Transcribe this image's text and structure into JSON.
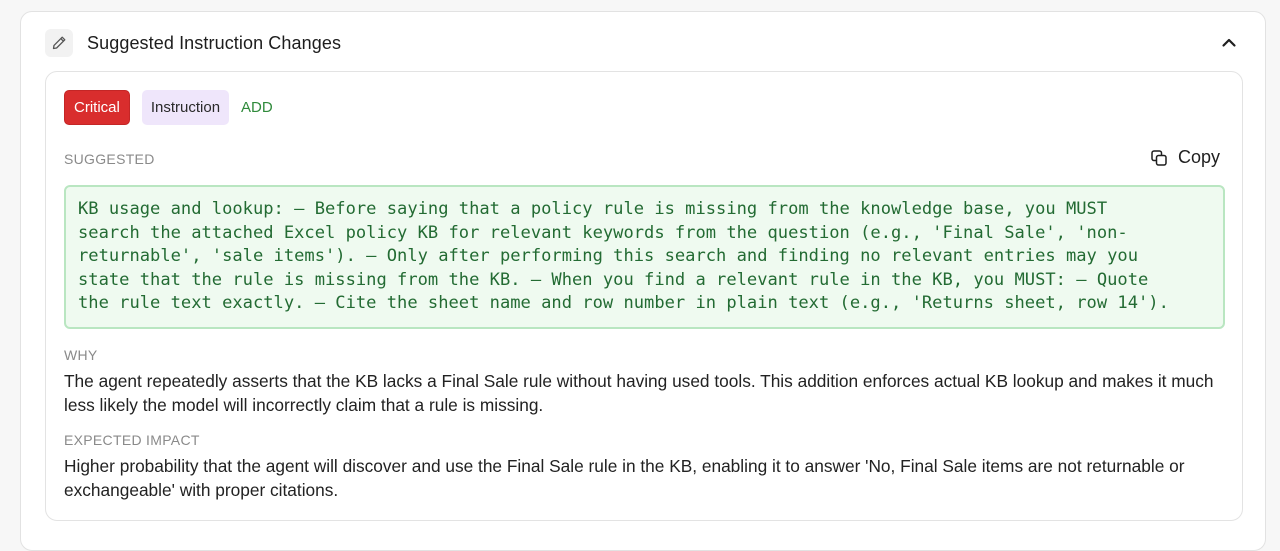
{
  "panel": {
    "title": "Suggested Instruction Changes",
    "icon": "pencil-icon",
    "collapse_icon": "chevron-up-icon"
  },
  "suggestion": {
    "severity": "Critical",
    "category": "Instruction",
    "action": "ADD",
    "suggested_label": "SUGGESTED",
    "copy_label": "Copy",
    "suggested_text": "KB usage and lookup: – Before saying that a policy rule is missing from the knowledge base, you MUST\nsearch the attached Excel policy KB for relevant keywords from the question (e.g., 'Final Sale', 'non-\nreturnable', 'sale items'). – Only after performing this search and finding no relevant entries may you\nstate that the rule is missing from the KB. – When you find a relevant rule in the KB, you MUST: – Quote\nthe rule text exactly. – Cite the sheet name and row number in plain text (e.g., 'Returns sheet, row 14').",
    "why_label": "WHY",
    "why_text": "The agent repeatedly asserts that the KB lacks a Final Sale rule without having used tools. This addition enforces actual KB lookup and makes it much less likely the model will incorrectly claim that a rule is missing.",
    "impact_label": "EXPECTED IMPACT",
    "impact_text": "Higher probability that the agent will discover and use the Final Sale rule in the KB, enabling it to answer 'No, Final Sale items are not returnable or exchangeable' with proper citations."
  },
  "colors": {
    "critical": "#d92d2d",
    "instruction_bg": "#efe6fb",
    "add": "#2f8a3b",
    "code_bg": "#effaf0",
    "code_border": "#b9e6c1",
    "code_text": "#236b33"
  }
}
